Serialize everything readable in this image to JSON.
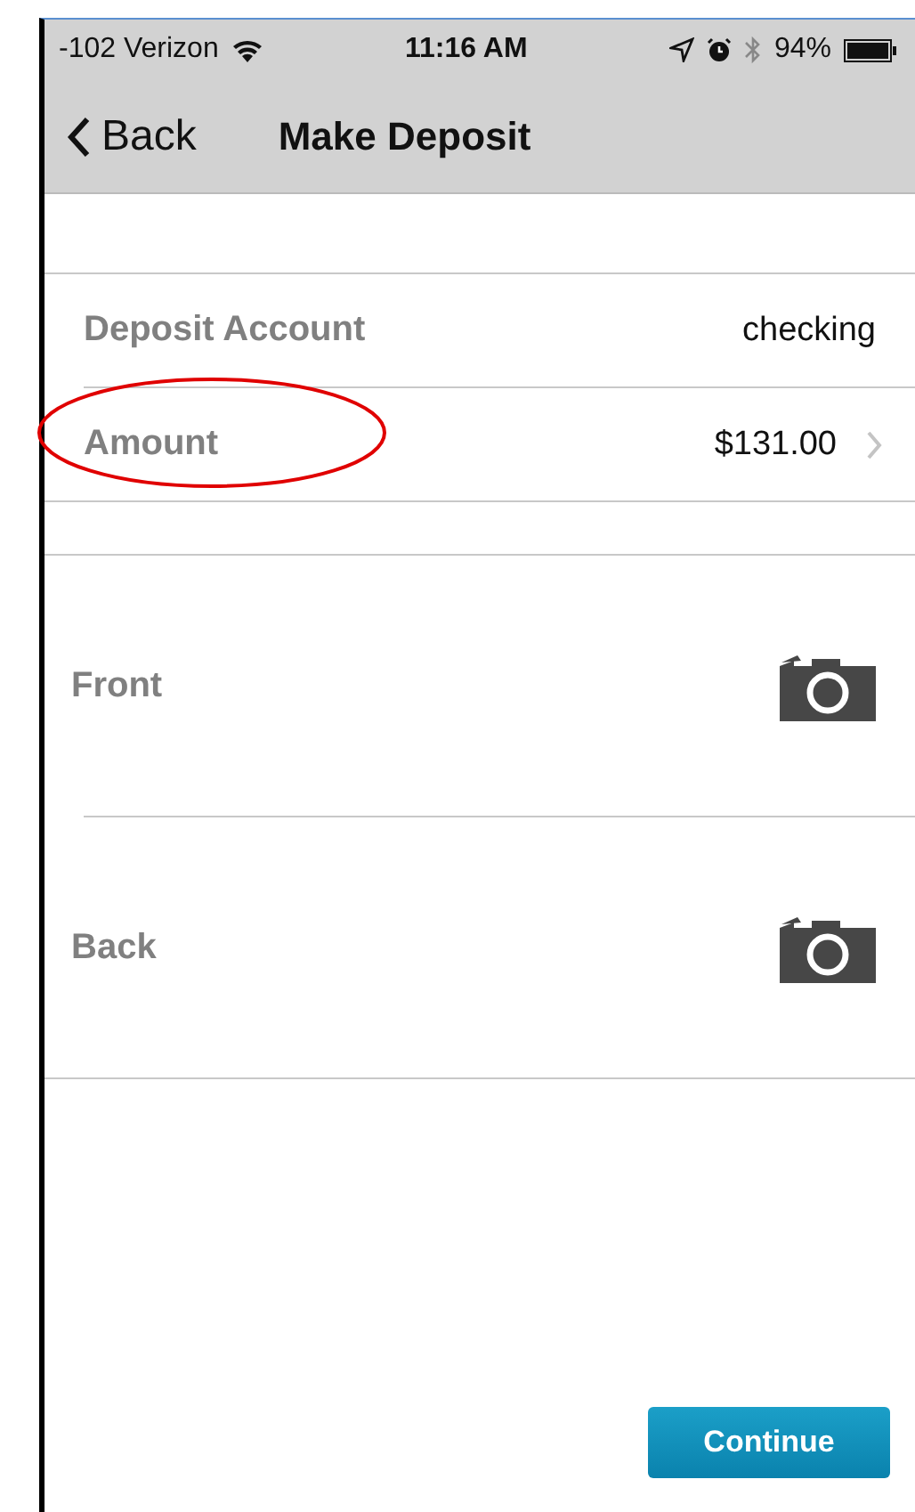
{
  "status_bar": {
    "carrier": "-102 Verizon",
    "time": "11:16 AM",
    "battery": "94%"
  },
  "nav_bar": {
    "back": "Back",
    "title": "Make Deposit"
  },
  "fields": [
    {
      "label": "Deposit Account",
      "value": "checking",
      "chevron": false,
      "circled": false
    },
    {
      "label": "Amount",
      "value": "$131.00",
      "chevron": true,
      "circled": true
    }
  ],
  "captures": [
    {
      "label": "Front"
    },
    {
      "label": "Back"
    }
  ],
  "continue_button": "Continue"
}
